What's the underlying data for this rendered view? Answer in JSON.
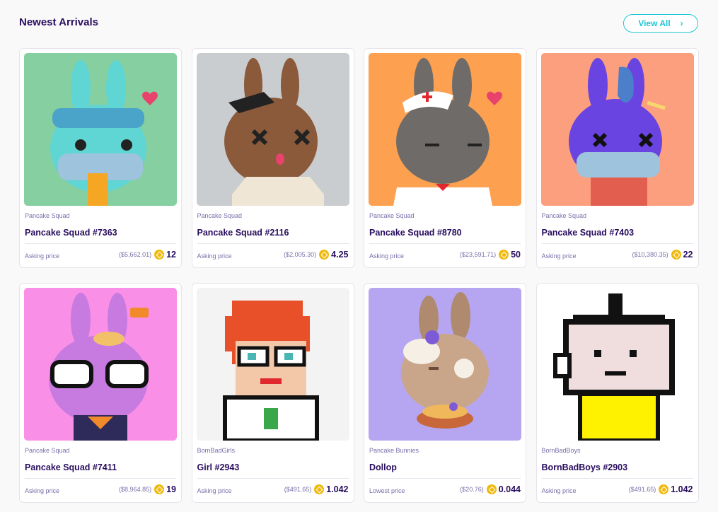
{
  "section": {
    "title": "Newest Arrivals",
    "view_all_label": "View All"
  },
  "cards": [
    {
      "collection": "Pancake Squad",
      "name": "Pancake Squad #7363",
      "price_label": "Asking price",
      "usd": "($5,662.01)",
      "bnb": "12",
      "bg": "#86cfa0",
      "icon": "squad-bunny-teal"
    },
    {
      "collection": "Pancake Squad",
      "name": "Pancake Squad #2116",
      "price_label": "Asking price",
      "usd": "($2,005.30)",
      "bnb": "4.25",
      "bg": "#c9cdd0",
      "icon": "squad-bunny-brown"
    },
    {
      "collection": "Pancake Squad",
      "name": "Pancake Squad #8780",
      "price_label": "Asking price",
      "usd": "($23,591.71)",
      "bnb": "50",
      "bg": "#fda04f",
      "icon": "squad-bunny-gray-nurse"
    },
    {
      "collection": "Pancake Squad",
      "name": "Pancake Squad #7403",
      "price_label": "Asking price",
      "usd": "($10,380.35)",
      "bnb": "22",
      "bg": "#fc9f7e",
      "icon": "squad-bunny-purple"
    },
    {
      "collection": "Pancake Squad",
      "name": "Pancake Squad #7411",
      "price_label": "Asking price",
      "usd": "($8,964.85)",
      "bnb": "19",
      "bg": "#f98fe6",
      "icon": "squad-bunny-pink-glasses"
    },
    {
      "collection": "BornBadGirls",
      "name": "Girl #2943",
      "price_label": "Asking price",
      "usd": "($491.65)",
      "bnb": "1.042",
      "bg": "#f3f3f3",
      "icon": "pixel-girl"
    },
    {
      "collection": "Pancake Bunnies",
      "name": "Dollop",
      "price_label": "Lowest price",
      "usd": "($20.76)",
      "bnb": "0.044",
      "bg": "#b6a6f2",
      "icon": "bunny-dollop"
    },
    {
      "collection": "BornBadBoys",
      "name": "BornBadBoys #2903",
      "price_label": "Asking price",
      "usd": "($491.65)",
      "bnb": "1.042",
      "bg": "#ffffff",
      "icon": "pixel-boy"
    }
  ]
}
